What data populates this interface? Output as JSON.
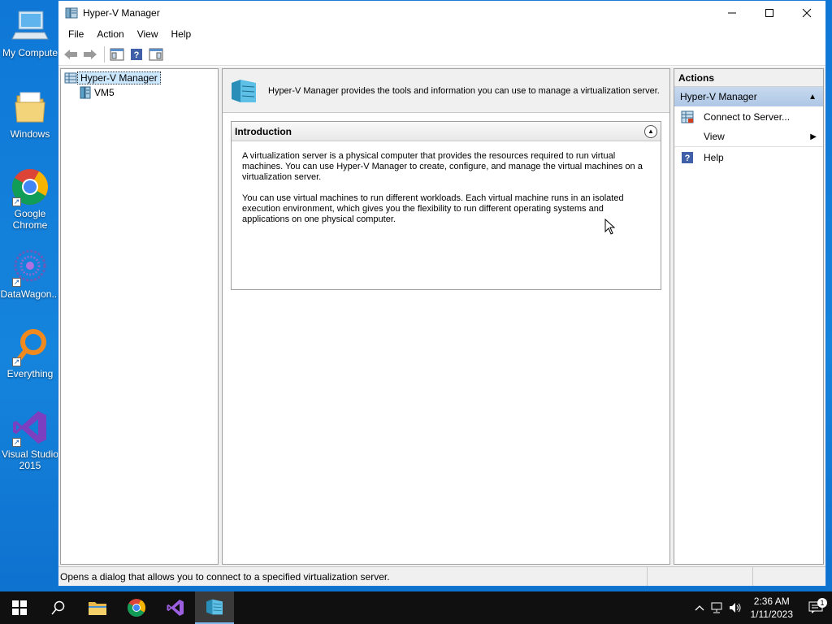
{
  "desktop": {
    "icons": [
      {
        "label": "My Compute"
      },
      {
        "label": "Windows"
      },
      {
        "label": "Google Chrome"
      },
      {
        "label": "DataWagon..."
      },
      {
        "label": "Everything"
      },
      {
        "label": "Visual Studio 2015"
      }
    ]
  },
  "window": {
    "title": "Hyper-V Manager",
    "menu": [
      "File",
      "Action",
      "View",
      "Help"
    ],
    "tree": {
      "root": "Hyper-V Manager",
      "child": "VM5"
    },
    "banner_text": "Hyper-V Manager provides the tools and information you can use to manage a virtualization server.",
    "intro": {
      "title": "Introduction",
      "para1": "A virtualization server is a physical computer that provides the resources required to run virtual machines. You can use Hyper-V Manager to create, configure, and manage the virtual machines on a virtualization server.",
      "para2": "You can use virtual machines to run different workloads. Each virtual machine runs in an isolated execution environment, which gives you the flexibility to run different operating systems and applications on one physical computer."
    },
    "actions": {
      "header": "Actions",
      "section": "Hyper-V Manager",
      "items": [
        "Connect to Server...",
        "View",
        "Help"
      ]
    },
    "status": "Opens a dialog that allows you to connect to a specified virtualization server."
  },
  "taskbar": {
    "time": "2:36 AM",
    "date": "1/11/2023",
    "notification_count": "1"
  }
}
